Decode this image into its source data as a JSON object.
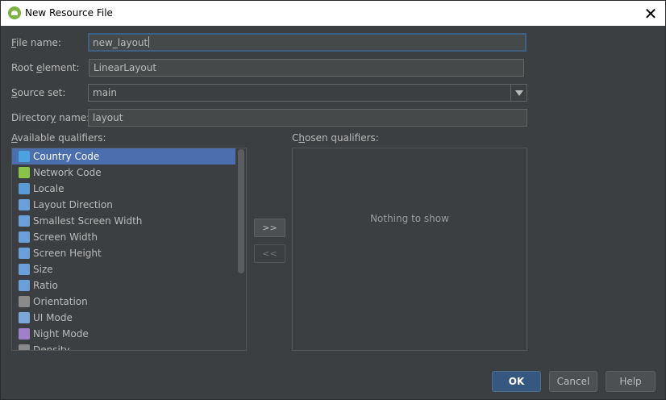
{
  "window": {
    "title": "New Resource File",
    "close_glyph": "✕"
  },
  "form": {
    "file_name": {
      "label_access": "F",
      "label_rest": "ile name:",
      "value": "new_layout"
    },
    "root_element": {
      "label_pre": "Root ",
      "label_access": "e",
      "label_rest": "lement:",
      "value": "LinearLayout"
    },
    "source_set": {
      "label_access": "S",
      "label_rest": "ource set:",
      "value": "main"
    },
    "directory_name": {
      "label_pre": "Director",
      "label_access": "y",
      "label_rest": " name:",
      "value": "layout"
    }
  },
  "available": {
    "label_access": "A",
    "label_rest": "vailable qualifiers:",
    "items": [
      {
        "label": "Country Code",
        "icon": "globe-icon",
        "color": "#4aa3df",
        "selected": true
      },
      {
        "label": "Network Code",
        "icon": "network-icon",
        "color": "#8bc34a"
      },
      {
        "label": "Locale",
        "icon": "locale-icon",
        "color": "#5b9bd5"
      },
      {
        "label": "Layout Direction",
        "icon": "layout-direction-icon",
        "color": "#6a9fd8"
      },
      {
        "label": "Smallest Screen Width",
        "icon": "smallest-width-icon",
        "color": "#6a9fd8"
      },
      {
        "label": "Screen Width",
        "icon": "screen-width-icon",
        "color": "#6a9fd8"
      },
      {
        "label": "Screen Height",
        "icon": "screen-height-icon",
        "color": "#6a9fd8"
      },
      {
        "label": "Size",
        "icon": "size-icon",
        "color": "#6a9fd8"
      },
      {
        "label": "Ratio",
        "icon": "ratio-icon",
        "color": "#6a9fd8"
      },
      {
        "label": "Orientation",
        "icon": "orientation-icon",
        "color": "#8a8a8a"
      },
      {
        "label": "UI Mode",
        "icon": "ui-mode-icon",
        "color": "#7aa7d8"
      },
      {
        "label": "Night Mode",
        "icon": "night-mode-icon",
        "color": "#a080c8"
      },
      {
        "label": "Density",
        "icon": "density-icon",
        "color": "#8a8a8a"
      }
    ]
  },
  "chosen": {
    "label_pre": "C",
    "label_access": "h",
    "label_rest": "osen qualifiers:",
    "empty_text": "Nothing to show"
  },
  "transfer": {
    "add": ">>",
    "remove": "<<"
  },
  "buttons": {
    "ok": "OK",
    "cancel": "Cancel",
    "help": "Help"
  }
}
